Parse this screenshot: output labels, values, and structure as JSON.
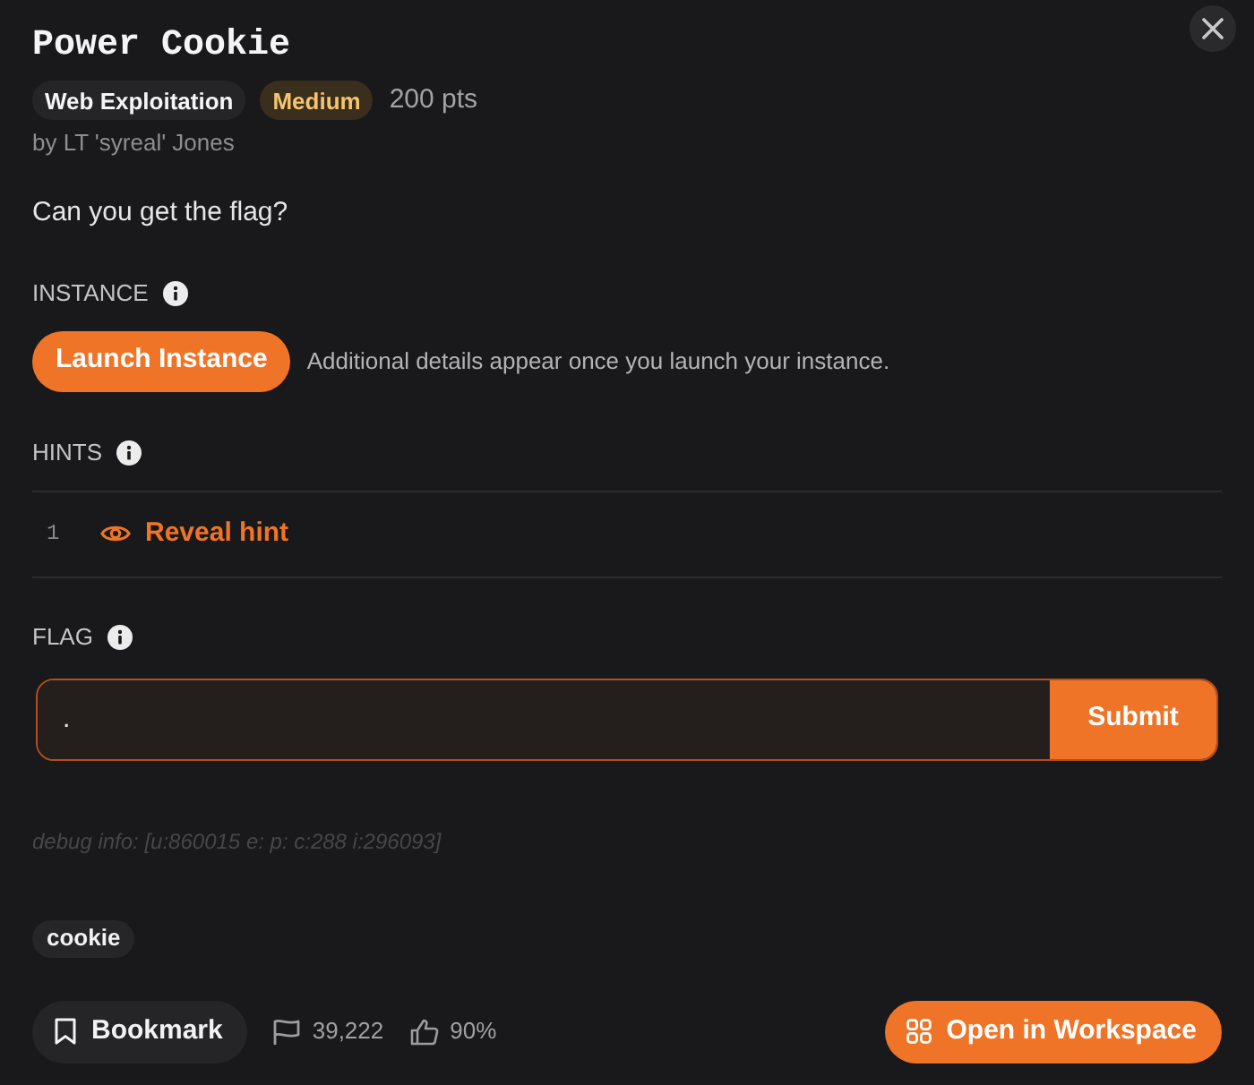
{
  "challenge": {
    "title": "Power Cookie",
    "tags": [
      {
        "label": "Web Exploitation",
        "kind": "category"
      },
      {
        "label": "Medium",
        "kind": "difficulty"
      }
    ],
    "points": "200 pts",
    "author": "by LT 'syreal' Jones",
    "description": "Can you get the flag?"
  },
  "instance": {
    "heading": "INSTANCE",
    "button": "Launch Instance",
    "note": "Additional details appear once you launch your instance."
  },
  "hints": {
    "heading": "HINTS",
    "items": [
      {
        "number": "1",
        "action": "Reveal hint"
      }
    ]
  },
  "flag": {
    "heading": "FLAG",
    "value": ".",
    "focused": true,
    "button": "Submit"
  },
  "debug_info": "debug info: [u:860015 e: p: c:288 i:296093]",
  "topics": [
    "cookie"
  ],
  "footer": {
    "bookmark": "Bookmark",
    "solves": "39,222",
    "rating": "90%",
    "workspace_button": "Open in Workspace"
  }
}
